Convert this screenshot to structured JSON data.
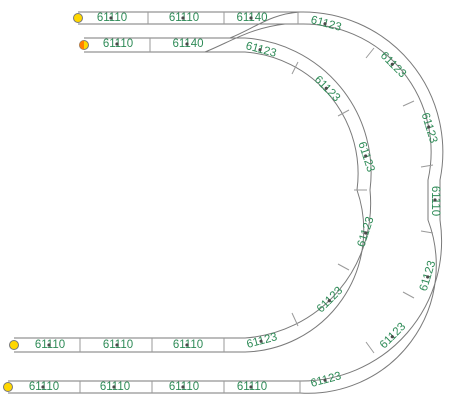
{
  "colors": {
    "rail": "#7a7a7a",
    "label": "#2e8b57",
    "marker": "#ffd700",
    "marker_active": "#ff7f00"
  },
  "tracks": {
    "outer_top": [
      "61110",
      "61110",
      "61140",
      "61123",
      "61123",
      "61123",
      "61110",
      "61123",
      "61123",
      "61123"
    ],
    "outer_bottom": [
      "61110",
      "61110",
      "61110",
      "61110"
    ],
    "inner_top": [
      "61110",
      "61140",
      "61123",
      "61123",
      "61123",
      "61123",
      "61123",
      "61123"
    ],
    "inner_bottom": [
      "61110",
      "61110",
      "61110"
    ]
  },
  "markers": [
    {
      "name": "end-marker-outer-top",
      "active": false
    },
    {
      "name": "end-marker-inner-top",
      "active": true
    },
    {
      "name": "end-marker-inner-bottom",
      "active": false
    },
    {
      "name": "end-marker-outer-bottom",
      "active": false
    }
  ]
}
